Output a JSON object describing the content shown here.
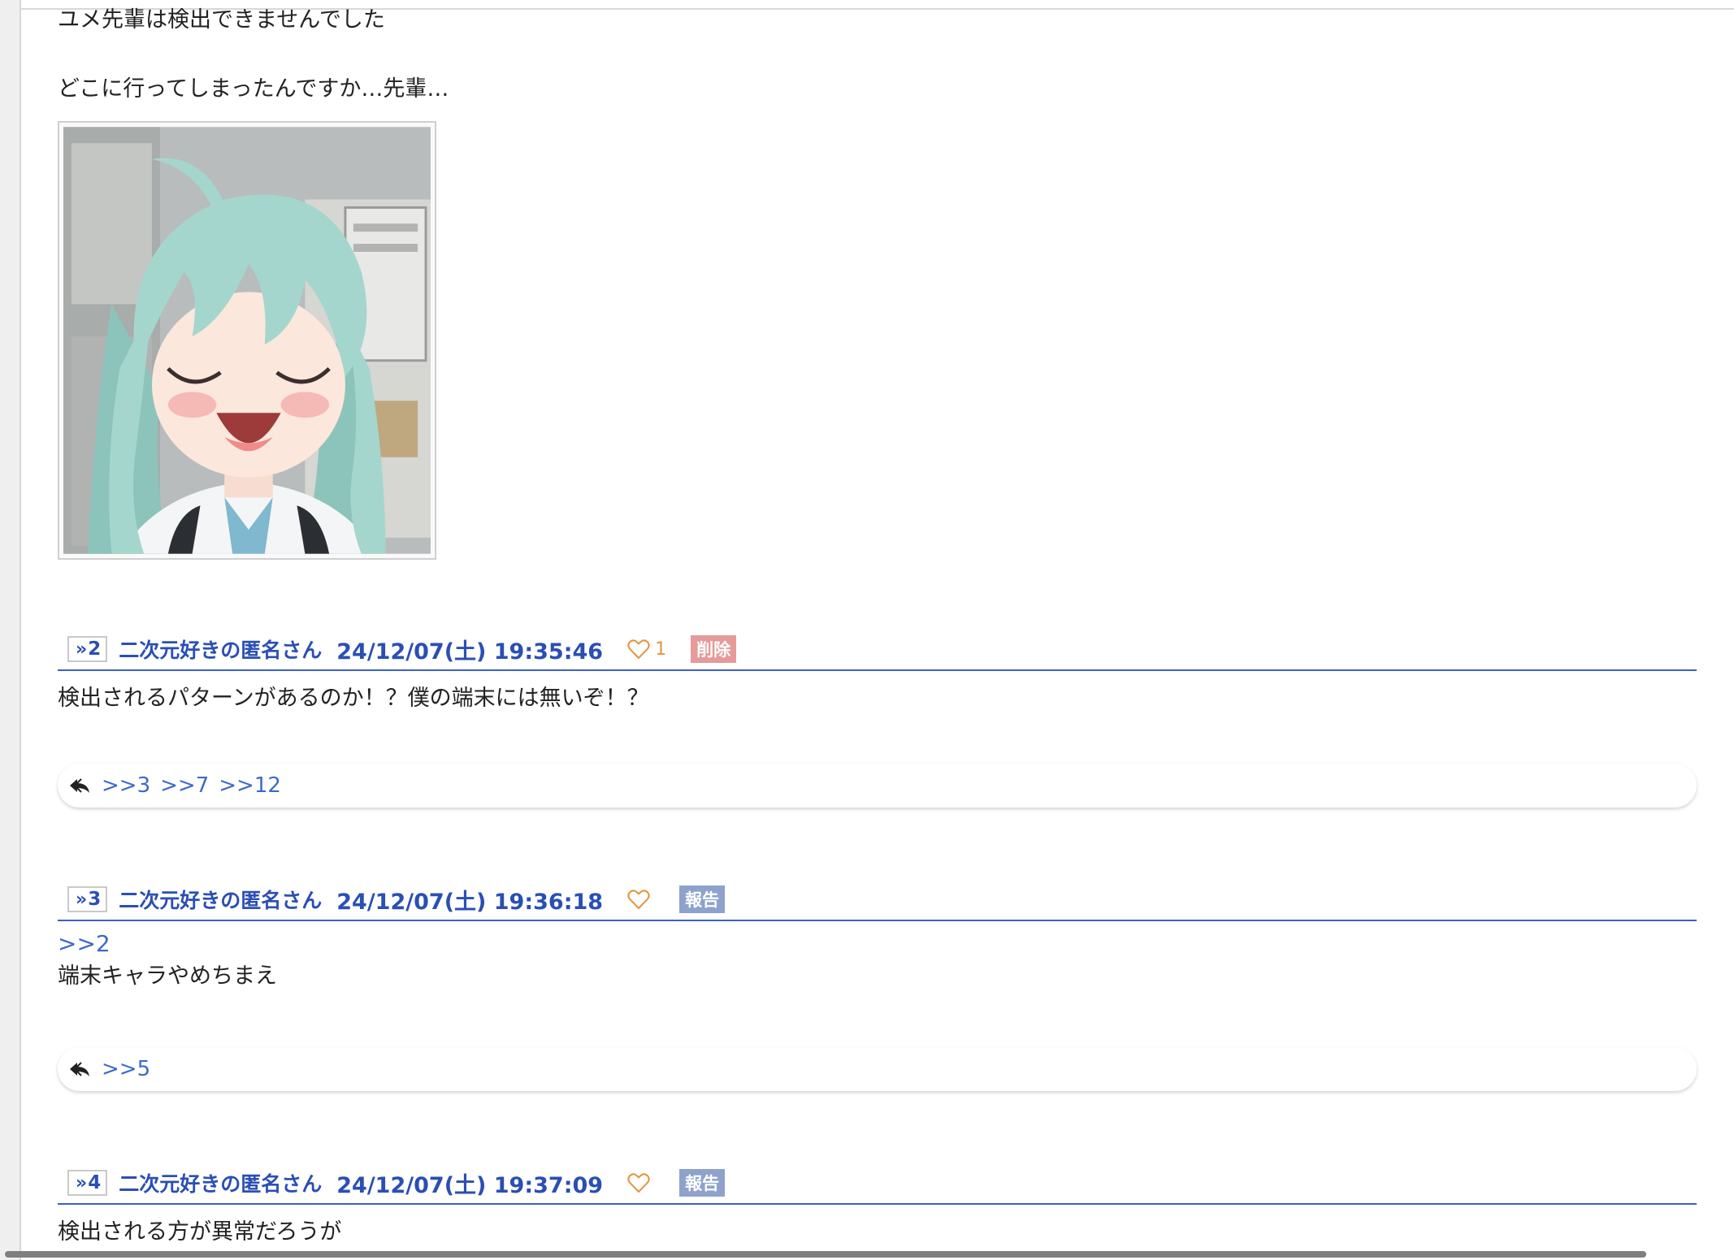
{
  "intro": {
    "line1": "ユメ先輩は検出できませんでした",
    "line2": "どこに行ってしまったんですか…先輩…"
  },
  "posts": [
    {
      "num": "2",
      "name": "二次元好きの匿名さん",
      "date": "24/12/07(土) 19:35:46",
      "likes": "1",
      "badge": "削除",
      "body_anchor": "",
      "body": "検出されるパターンがあるのか！？僕の端末には無いぞ！？",
      "replies": [
        ">>3",
        ">>7",
        ">>12"
      ]
    },
    {
      "num": "3",
      "name": "二次元好きの匿名さん",
      "date": "24/12/07(土) 19:36:18",
      "likes": "",
      "badge": "報告",
      "body_anchor": ">>2",
      "body": "端末キャラやめちまえ",
      "replies": [
        ">>5"
      ]
    },
    {
      "num": "4",
      "name": "二次元好きの匿名さん",
      "date": "24/12/07(土) 19:37:09",
      "likes": "",
      "badge": "報告",
      "body_anchor": "",
      "body": "検出される方が異常だろうが",
      "replies": []
    }
  ],
  "icons": {
    "like": "heart-outline-icon",
    "reply": "reply-arrow-icon",
    "anchor": "double-chevron-icon"
  },
  "colors": {
    "accent": "#2a4fb4",
    "link": "#3d6ac9",
    "heart": "#e2953d",
    "delete_badge": "#e69a9a",
    "report_badge": "#8ea2cc"
  }
}
